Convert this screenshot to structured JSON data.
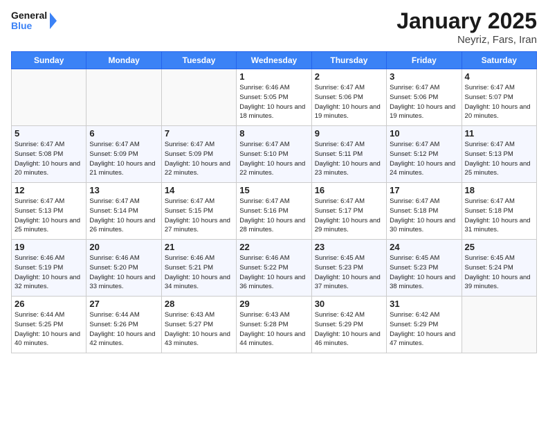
{
  "header": {
    "logo_line1": "General",
    "logo_line2": "Blue",
    "title": "January 2025",
    "subtitle": "Neyriz, Fars, Iran"
  },
  "days_of_week": [
    "Sunday",
    "Monday",
    "Tuesday",
    "Wednesday",
    "Thursday",
    "Friday",
    "Saturday"
  ],
  "weeks": [
    [
      {
        "day": null
      },
      {
        "day": null
      },
      {
        "day": null
      },
      {
        "day": "1",
        "sunrise": "6:46 AM",
        "sunset": "5:05 PM",
        "daylight": "10 hours and 18 minutes."
      },
      {
        "day": "2",
        "sunrise": "6:47 AM",
        "sunset": "5:06 PM",
        "daylight": "10 hours and 19 minutes."
      },
      {
        "day": "3",
        "sunrise": "6:47 AM",
        "sunset": "5:06 PM",
        "daylight": "10 hours and 19 minutes."
      },
      {
        "day": "4",
        "sunrise": "6:47 AM",
        "sunset": "5:07 PM",
        "daylight": "10 hours and 20 minutes."
      }
    ],
    [
      {
        "day": "5",
        "sunrise": "6:47 AM",
        "sunset": "5:08 PM",
        "daylight": "10 hours and 20 minutes."
      },
      {
        "day": "6",
        "sunrise": "6:47 AM",
        "sunset": "5:09 PM",
        "daylight": "10 hours and 21 minutes."
      },
      {
        "day": "7",
        "sunrise": "6:47 AM",
        "sunset": "5:09 PM",
        "daylight": "10 hours and 22 minutes."
      },
      {
        "day": "8",
        "sunrise": "6:47 AM",
        "sunset": "5:10 PM",
        "daylight": "10 hours and 22 minutes."
      },
      {
        "day": "9",
        "sunrise": "6:47 AM",
        "sunset": "5:11 PM",
        "daylight": "10 hours and 23 minutes."
      },
      {
        "day": "10",
        "sunrise": "6:47 AM",
        "sunset": "5:12 PM",
        "daylight": "10 hours and 24 minutes."
      },
      {
        "day": "11",
        "sunrise": "6:47 AM",
        "sunset": "5:13 PM",
        "daylight": "10 hours and 25 minutes."
      }
    ],
    [
      {
        "day": "12",
        "sunrise": "6:47 AM",
        "sunset": "5:13 PM",
        "daylight": "10 hours and 25 minutes."
      },
      {
        "day": "13",
        "sunrise": "6:47 AM",
        "sunset": "5:14 PM",
        "daylight": "10 hours and 26 minutes."
      },
      {
        "day": "14",
        "sunrise": "6:47 AM",
        "sunset": "5:15 PM",
        "daylight": "10 hours and 27 minutes."
      },
      {
        "day": "15",
        "sunrise": "6:47 AM",
        "sunset": "5:16 PM",
        "daylight": "10 hours and 28 minutes."
      },
      {
        "day": "16",
        "sunrise": "6:47 AM",
        "sunset": "5:17 PM",
        "daylight": "10 hours and 29 minutes."
      },
      {
        "day": "17",
        "sunrise": "6:47 AM",
        "sunset": "5:18 PM",
        "daylight": "10 hours and 30 minutes."
      },
      {
        "day": "18",
        "sunrise": "6:47 AM",
        "sunset": "5:18 PM",
        "daylight": "10 hours and 31 minutes."
      }
    ],
    [
      {
        "day": "19",
        "sunrise": "6:46 AM",
        "sunset": "5:19 PM",
        "daylight": "10 hours and 32 minutes."
      },
      {
        "day": "20",
        "sunrise": "6:46 AM",
        "sunset": "5:20 PM",
        "daylight": "10 hours and 33 minutes."
      },
      {
        "day": "21",
        "sunrise": "6:46 AM",
        "sunset": "5:21 PM",
        "daylight": "10 hours and 34 minutes."
      },
      {
        "day": "22",
        "sunrise": "6:46 AM",
        "sunset": "5:22 PM",
        "daylight": "10 hours and 36 minutes."
      },
      {
        "day": "23",
        "sunrise": "6:45 AM",
        "sunset": "5:23 PM",
        "daylight": "10 hours and 37 minutes."
      },
      {
        "day": "24",
        "sunrise": "6:45 AM",
        "sunset": "5:23 PM",
        "daylight": "10 hours and 38 minutes."
      },
      {
        "day": "25",
        "sunrise": "6:45 AM",
        "sunset": "5:24 PM",
        "daylight": "10 hours and 39 minutes."
      }
    ],
    [
      {
        "day": "26",
        "sunrise": "6:44 AM",
        "sunset": "5:25 PM",
        "daylight": "10 hours and 40 minutes."
      },
      {
        "day": "27",
        "sunrise": "6:44 AM",
        "sunset": "5:26 PM",
        "daylight": "10 hours and 42 minutes."
      },
      {
        "day": "28",
        "sunrise": "6:43 AM",
        "sunset": "5:27 PM",
        "daylight": "10 hours and 43 minutes."
      },
      {
        "day": "29",
        "sunrise": "6:43 AM",
        "sunset": "5:28 PM",
        "daylight": "10 hours and 44 minutes."
      },
      {
        "day": "30",
        "sunrise": "6:42 AM",
        "sunset": "5:29 PM",
        "daylight": "10 hours and 46 minutes."
      },
      {
        "day": "31",
        "sunrise": "6:42 AM",
        "sunset": "5:29 PM",
        "daylight": "10 hours and 47 minutes."
      },
      {
        "day": null
      }
    ]
  ],
  "labels": {
    "sunrise_prefix": "Sunrise: ",
    "sunset_prefix": "Sunset: ",
    "daylight_prefix": "Daylight: "
  }
}
